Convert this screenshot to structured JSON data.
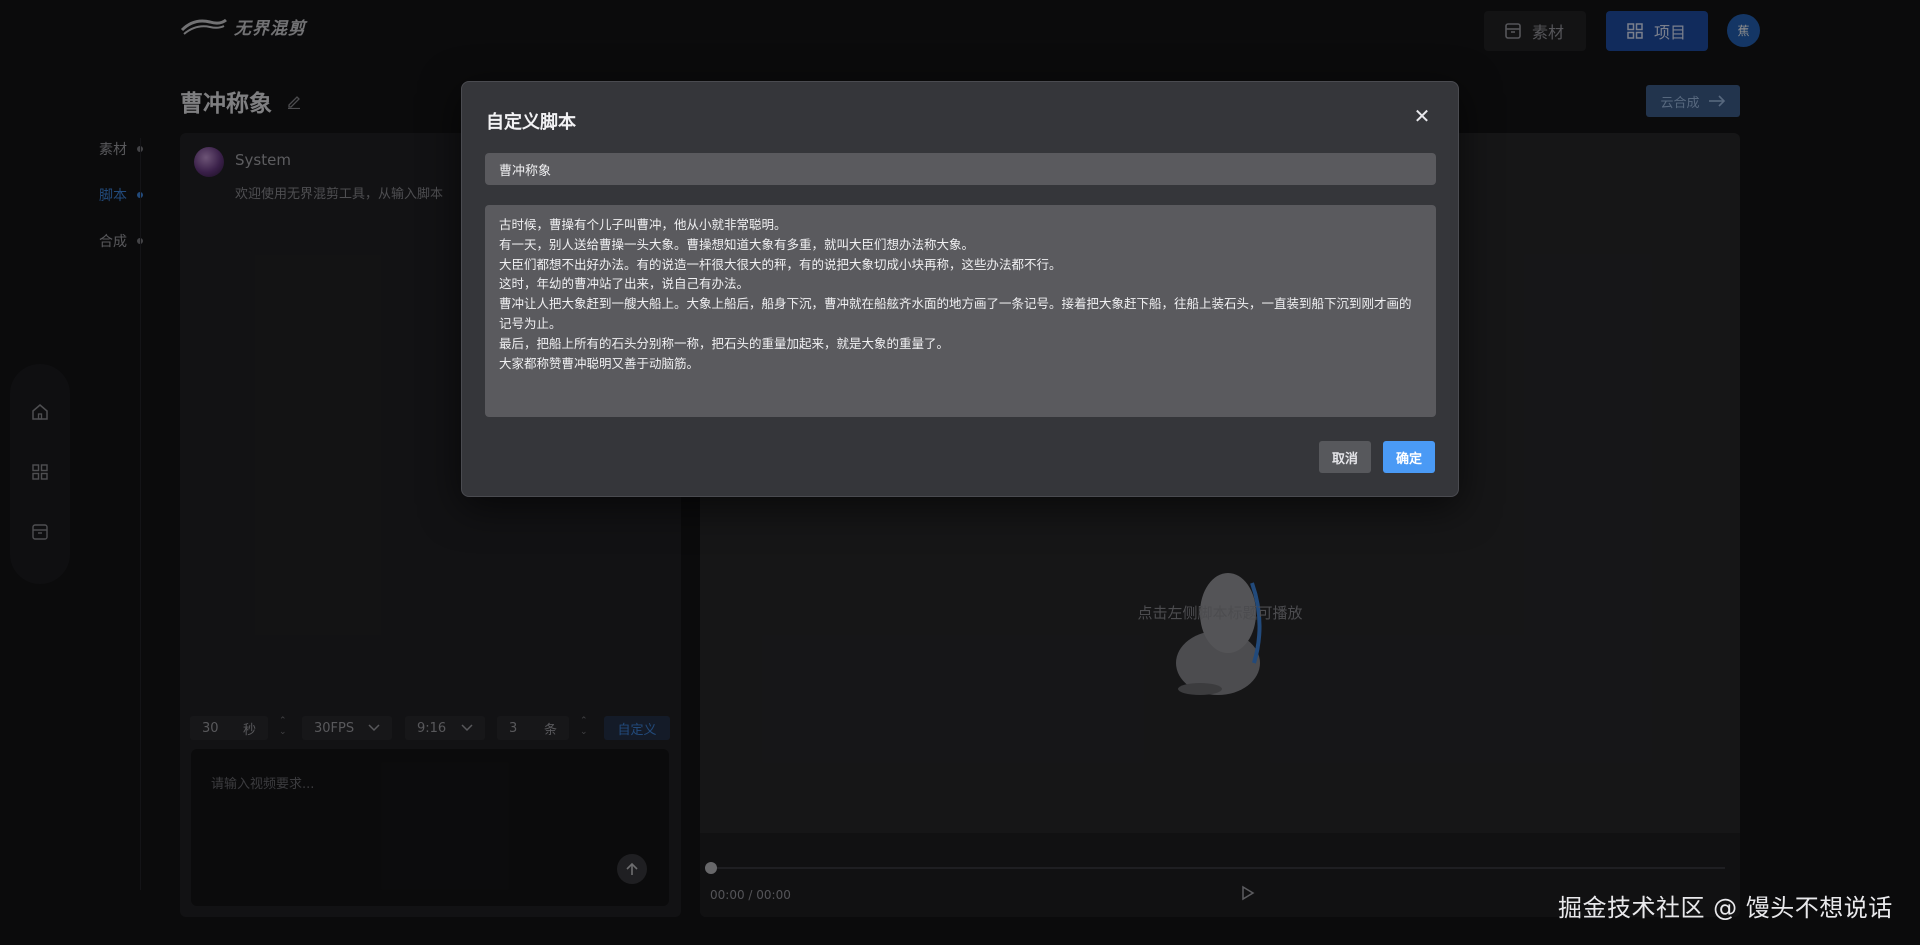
{
  "header": {
    "logo_text": "无界混剪",
    "materials_label": "素材",
    "projects_label": "项目",
    "avatar_text": "蕉"
  },
  "page": {
    "title": "曹冲称象",
    "cloud_button": "云合成"
  },
  "steps": [
    {
      "label": "素材",
      "active": false
    },
    {
      "label": "脚本",
      "active": true
    },
    {
      "label": "合成",
      "active": false
    }
  ],
  "side_nav": [
    "home-icon",
    "grid-icon",
    "archive-icon"
  ],
  "chat": {
    "sender": "System",
    "message": "欢迎使用无界混剪工具，从输入脚本"
  },
  "controls": {
    "duration_value": "30",
    "duration_unit": "秒",
    "fps": "30FPS",
    "ratio": "9:16",
    "count_value": "3",
    "count_unit": "条",
    "custom_label": "自定义"
  },
  "prompt_input": {
    "placeholder": "请输入视频要求..."
  },
  "preview": {
    "hint": "点击左侧脚本标题可播放",
    "time": "00:00 / 00:00",
    "progress": 0
  },
  "modal": {
    "title": "自定义脚本",
    "script_title": "曹冲称象",
    "script_lines": [
      "古时候，曹操有个儿子叫曹冲，他从小就非常聪明。",
      "有一天，别人送给曹操一头大象。曹操想知道大象有多重，就叫大臣们想办法称大象。",
      "大臣们都想不出好办法。有的说造一杆很大很大的秤，有的说把大象切成小块再称，这些办法都不行。",
      "这时，年幼的曹冲站了出来，说自己有办法。",
      "曹冲让人把大象赶到一艘大船上。大象上船后，船身下沉，曹冲就在船舷齐水面的地方画了一条记号。接着把大象赶下船，往船上装石头，一直装到船下沉到刚才画的记号为止。",
      "最后，把船上所有的石头分别称一称，把石头的重量加起来，就是大象的重量了。",
      "大家都称赞曹冲聪明又善于动脑筋。"
    ],
    "cancel_label": "取消",
    "confirm_label": "确定"
  },
  "watermark": "掘金技术社区 @ 馒头不想说话"
}
